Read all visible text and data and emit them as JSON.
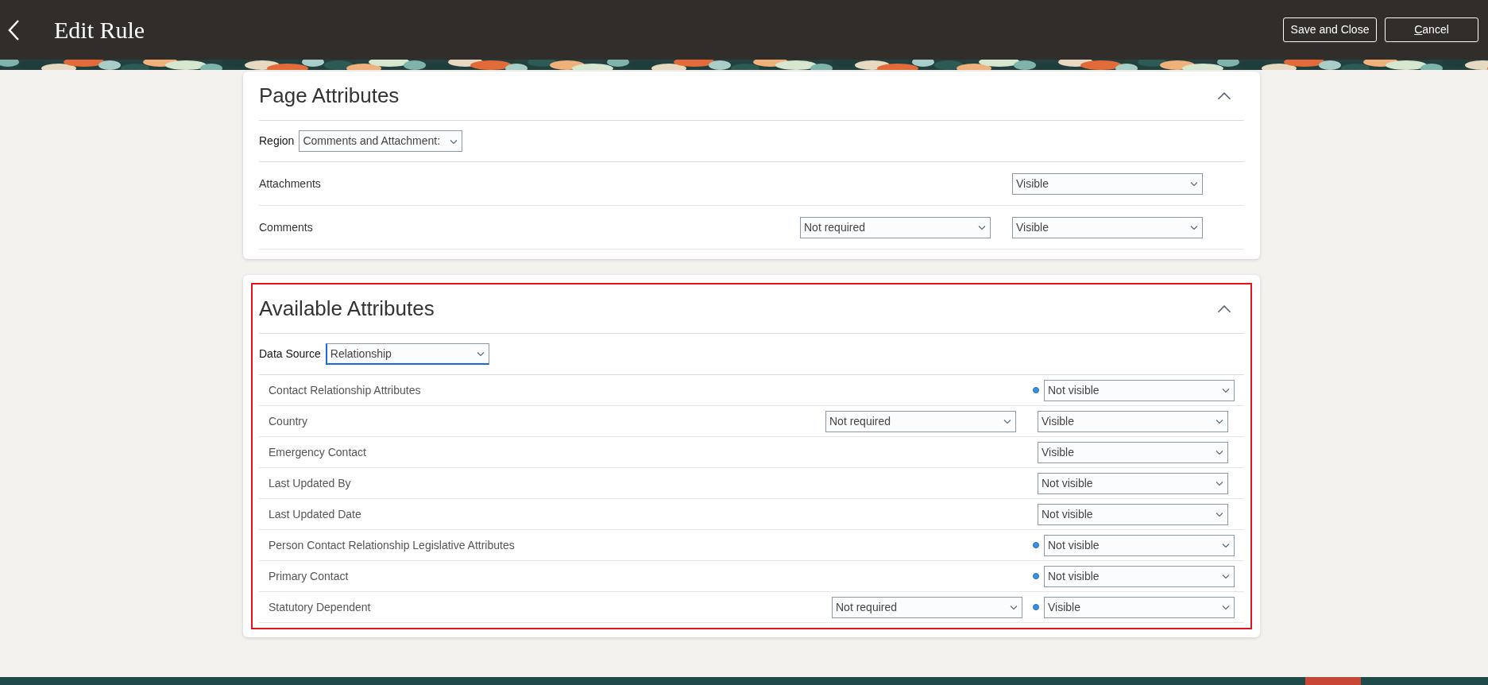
{
  "header": {
    "title": "Edit Rule",
    "buttons": [
      "Save and Close",
      "Cancel"
    ]
  },
  "page_attributes": {
    "title": "Page Attributes",
    "expanded": true,
    "region": {
      "label": "Region",
      "value": "Comments and Attachment:"
    },
    "rows": [
      {
        "label": "Attachments",
        "visibility": "Visible"
      },
      {
        "label": "Comments",
        "required": "Not required",
        "visibility": "Visible"
      }
    ]
  },
  "available_attributes": {
    "title": "Available Attributes",
    "expanded": true,
    "highlighted": true,
    "data_source": {
      "label": "Data Source",
      "value": "Relationship",
      "focused": true
    },
    "rows": [
      {
        "label": "Contact Relationship Attributes",
        "modified": true,
        "visibility": "Not visible"
      },
      {
        "label": "Country",
        "modified": false,
        "required": "Not required",
        "visibility": "Visible"
      },
      {
        "label": "Emergency Contact",
        "modified": false,
        "visibility": "Visible"
      },
      {
        "label": "Last Updated By",
        "modified": false,
        "visibility": "Not visible"
      },
      {
        "label": "Last Updated Date",
        "modified": false,
        "visibility": "Not visible"
      },
      {
        "label": "Person Contact Relationship Legislative Attributes",
        "modified": true,
        "visibility": "Not visible"
      },
      {
        "label": "Primary Contact",
        "modified": true,
        "visibility": "Not visible"
      },
      {
        "label": "Statutory Dependent",
        "modified": true,
        "required": "Not required",
        "visibility": "Visible"
      }
    ]
  }
}
